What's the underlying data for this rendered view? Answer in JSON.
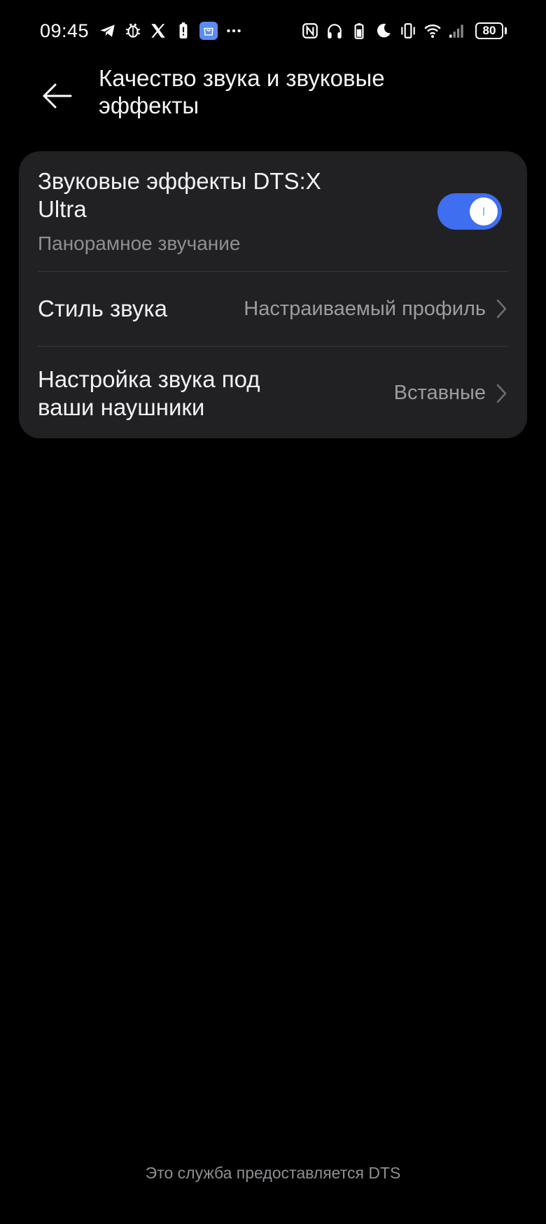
{
  "status_bar": {
    "time": "09:45",
    "left_icons": [
      "telegram-icon",
      "bug-icon",
      "x-logo-icon",
      "battery-saver-icon",
      "app-store-icon",
      "more-dots-icon"
    ],
    "right_icons": [
      "nfc-icon",
      "headphones-icon",
      "battery-small-icon",
      "moon-icon",
      "vibrate-icon",
      "wifi-icon",
      "signal-icon"
    ],
    "battery_level": "80"
  },
  "header": {
    "back_icon": "arrow-left-icon",
    "title": "Качество звука и звуковые эффекты"
  },
  "settings": {
    "dts": {
      "title": "Звуковые эффекты DTS:X Ultra",
      "subtitle": "Панорамное звучание",
      "enabled": true
    },
    "sound_style": {
      "title": "Стиль звука",
      "value": "Настраиваемый профиль"
    },
    "headphone_fit": {
      "title": "Настройка звука под ваши наушники",
      "value": "Вставные"
    }
  },
  "footer": {
    "text": "Это служба предоставляется DTS"
  },
  "colors": {
    "background": "#000000",
    "card": "#212124",
    "accent": "#3f6ef0",
    "secondary_text": "#8e8e93"
  }
}
